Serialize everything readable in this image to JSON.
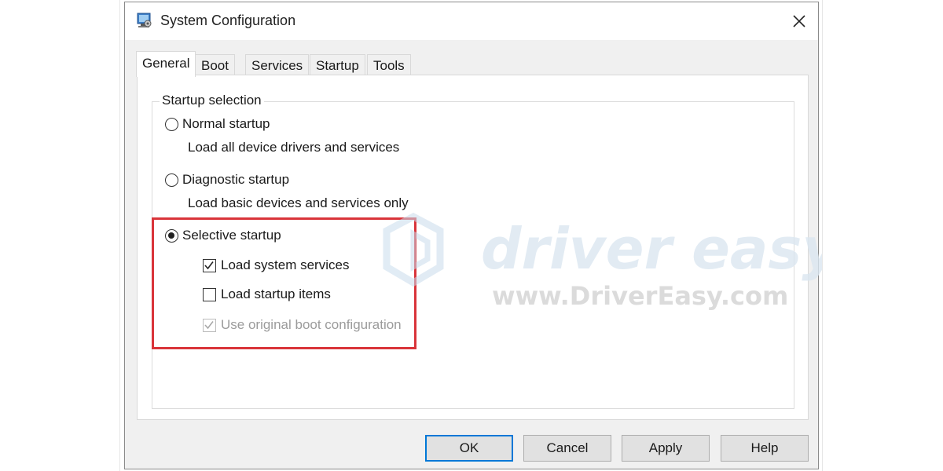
{
  "window": {
    "title": "System Configuration",
    "close_label": "✕"
  },
  "tabs": [
    {
      "label": "General",
      "active": true
    },
    {
      "label": "Boot"
    },
    {
      "label": "Services"
    },
    {
      "label": "Startup"
    },
    {
      "label": "Tools"
    }
  ],
  "startup_selection": {
    "legend": "Startup selection",
    "normal": {
      "label": "Normal startup",
      "description": "Load all device drivers and services",
      "selected": false
    },
    "diagnostic": {
      "label": "Diagnostic startup",
      "description": "Load basic devices and services only",
      "selected": false
    },
    "selective": {
      "label": "Selective startup",
      "selected": true,
      "options": {
        "load_system_services": {
          "label": "Load system services",
          "checked": true
        },
        "load_startup_items": {
          "label": "Load startup items",
          "checked": false
        },
        "use_original_boot": {
          "label": "Use original boot configuration",
          "checked": true,
          "disabled": true
        }
      }
    }
  },
  "buttons": {
    "ok": "OK",
    "cancel": "Cancel",
    "apply": "Apply",
    "help": "Help"
  },
  "watermark": {
    "brand": "driver easy",
    "url": "www.DriverEasy.com"
  },
  "colors": {
    "highlight": "#d9343a",
    "default_button_border": "#0078d7",
    "watermark": "#dbe7f1"
  }
}
